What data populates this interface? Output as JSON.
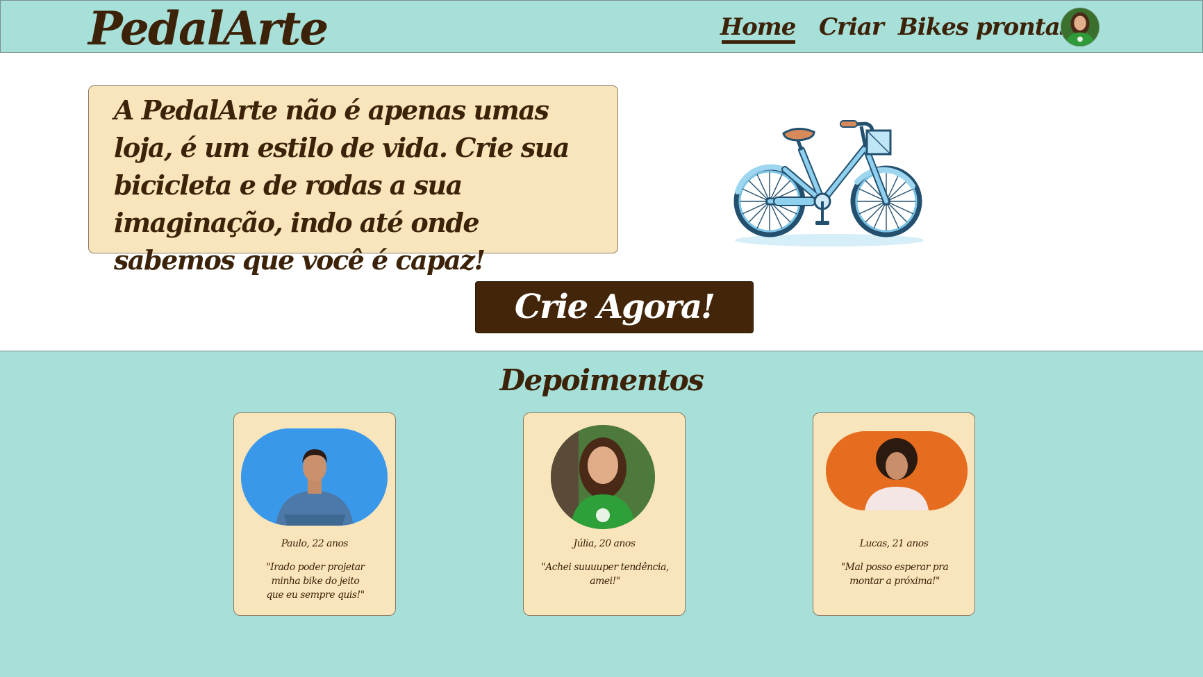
{
  "header": {
    "logo": "PedalArte",
    "nav": [
      {
        "label": "Home",
        "active": true
      },
      {
        "label": "Criar"
      },
      {
        "label": "Bikes prontas"
      }
    ],
    "avatar_icon": "user-avatar"
  },
  "hero": {
    "text": "A PedalArte não é apenas umas loja, é um estilo de vida. Crie sua bicicleta e de rodas a sua imaginação, indo até onde sabemos que você é capaz!",
    "illustration_icon": "bicycle-icon",
    "cta_label": "Crie Agora!"
  },
  "testimonials": {
    "title": "Depoimentos",
    "items": [
      {
        "name": "Paulo, 22 anos",
        "quote": "\"Irado poder projetar minha bike do jeito que eu sempre quis!\"",
        "photo_bg": "#2b8ee8"
      },
      {
        "name": "Júlia, 20 anos",
        "quote": "\"Achei suuuuper tendência, amei!\"",
        "photo_bg": "#3f6e34"
      },
      {
        "name": "Lucas, 21 anos",
        "quote": "\"Mal posso esperar pra montar a próxima!\"",
        "photo_bg": "#e87a31"
      }
    ]
  },
  "colors": {
    "teal": "#a7dfd9",
    "cream": "#f8e5bb",
    "brown": "#3b2208",
    "button": "#432609"
  }
}
